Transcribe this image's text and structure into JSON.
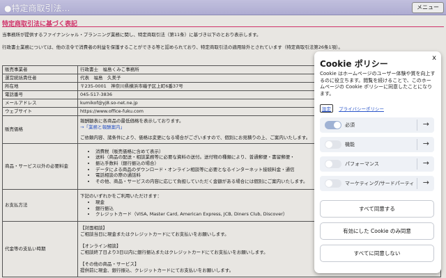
{
  "header": {
    "title": "●特定商取引法…",
    "menu_label": "メニュー"
  },
  "page": {
    "heading": "特定商取引法に基づく表記",
    "intro1": "当事務所が提供するファイナンシャル・プランニング業務に関し、特定商取引法（第11条）に基づき以下のとおり表示します。",
    "intro2": "行政書士業務については、他の法令で消費者の利益を保護することができる等と認められており、特定商取引法の適用除外とされています（特定商取引法第26条1項）。",
    "rows": {
      "seller": {
        "label": "販売事業者",
        "value": "行政書士　福島くみこ事務所"
      },
      "manager": {
        "label": "運営統括責任者",
        "value": "代表　福島　久美子"
      },
      "address": {
        "label": "所在地",
        "value": "〒235-0001　神奈川県横浜市磯子区上町6番37号"
      },
      "phone": {
        "label": "電話番号",
        "value": "045-517-3836"
      },
      "email": {
        "label": "メールアドレス",
        "value": "kumikof@yj8.so-net.ne.jp"
      },
      "website": {
        "label": "ウェブサイト",
        "value": "https://www.office-fuku.com"
      },
      "price": {
        "label": "販売価格",
        "line1": "報酬額表に各商品の最低価格を表示しております。",
        "link": "→「業務と報酬案内」",
        "line2": "ご依頼内容、諸条件により、価格は変更になる場合がございますので、個別にお見積りの上、ご案内いたします。"
      },
      "other_fees": {
        "label": "商品・サービス以外の必要料金",
        "items": [
          "消費税（販売価格に含めて表示）",
          "送料（商品の配送・相談業務等に必要な資料の送付。送付物の種類により、普通郵便・書留郵便・",
          "振込手数料（銀行振込の場合）",
          "データによる商品のダウンロード・オンライン相談等に必要となるインターネット接続料金・通信",
          "電話相談の際の通話料",
          "その他、商品・サービスの内容に応じて負担していただく金額がある場合には個別にご案内いたします。"
        ]
      },
      "payment": {
        "label": "お支払方法",
        "intro": "下記のいずれかをご利用いただけます：",
        "items": [
          "現金",
          "銀行振込",
          "クレジットカード（VISA, Master Card, American Express, JCB, Diners Club, Discover）"
        ]
      },
      "timing": {
        "label": "代金等の支払い時期",
        "lines": [
          "【対面相談】",
          "ご相談当日に現金またはクレジットカードにてお支払いをお願いします。",
          "",
          "【オンライン相談】",
          "ご相談終了日より3日以内に銀行振込またはクレジットカードにてお支払いをお願いします。",
          "",
          "【その他の商品・サービス】",
          "提供前に現金、銀行振込、クレジットカードにてお支払いをお願いします。"
        ]
      }
    }
  },
  "cookie_panel": {
    "close_label": "x",
    "title": "Cookie ポリシー",
    "body": "Cookie はホームページのユーザー体験や質を向上するのに役立ちます。閲覧を続けることで、このホームページの Cookie ポリシーに同意したことになります。",
    "link_details": "設定",
    "link_privacy": "プライバシーポリシー",
    "categories": [
      {
        "label": "必須",
        "enabled": true
      },
      {
        "label": "機能",
        "enabled": false
      },
      {
        "label": "パフォーマンス",
        "enabled": false
      },
      {
        "label": "マーケティング/サードパーティ",
        "enabled": false
      }
    ],
    "arrow_glyph": "→",
    "buttons": {
      "accept_all": "すべて同意する",
      "accept_selected": "有効にした Cookie のみ同意",
      "reject_all": "すべてに同意しない"
    }
  }
}
